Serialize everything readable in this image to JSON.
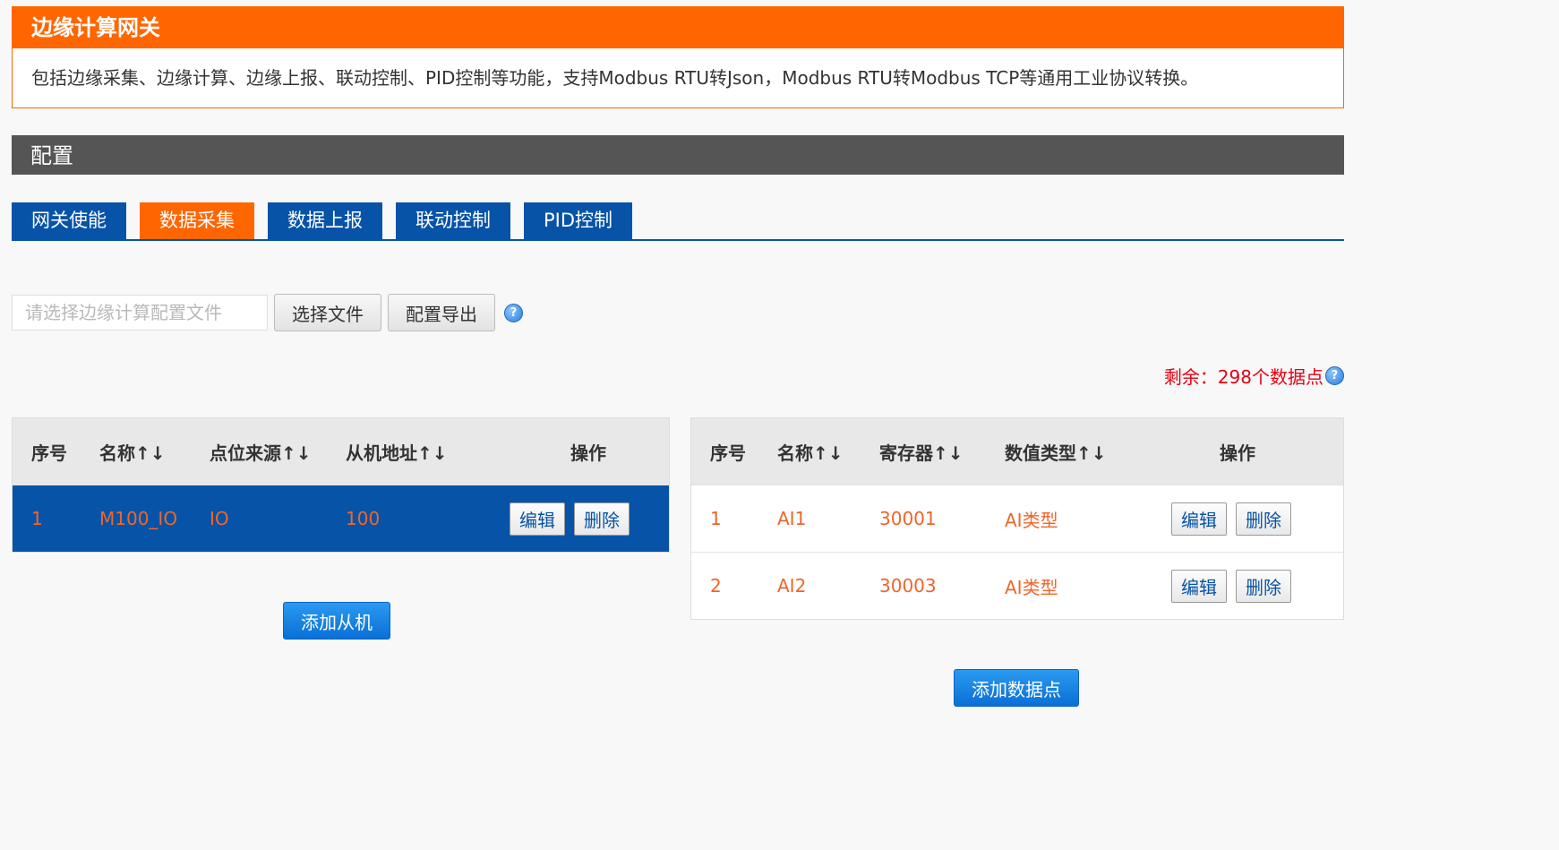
{
  "intro": {
    "title": "边缘计算网关",
    "description": "包括边缘采集、边缘计算、边缘上报、联动控制、PID控制等功能，支持Modbus RTU转Json，Modbus RTU转Modbus TCP等通用工业协议转换。"
  },
  "config": {
    "title": "配置",
    "tabs": [
      {
        "label": "网关使能",
        "active": false
      },
      {
        "label": "数据采集",
        "active": true
      },
      {
        "label": "数据上报",
        "active": false
      },
      {
        "label": "联动控制",
        "active": false
      },
      {
        "label": "PID控制",
        "active": false
      }
    ]
  },
  "file": {
    "placeholder": "请选择边缘计算配置文件",
    "value": "",
    "choose_label": "选择文件",
    "export_label": "配置导出",
    "help_icon": "question-circle-icon"
  },
  "remaining": {
    "text": "剩余：298个数据点"
  },
  "slave_table": {
    "headers": [
      "序号",
      "名称↑↓",
      "点位来源↑↓",
      "从机地址↑↓",
      "操作"
    ],
    "rows": [
      {
        "index": "1",
        "name": "M100_IO",
        "source": "IO",
        "address": "100",
        "selected": true
      }
    ],
    "edit_label": "编辑",
    "delete_label": "删除",
    "add_label": "添加从机"
  },
  "point_table": {
    "headers": [
      "序号",
      "名称↑↓",
      "寄存器↑↓",
      "数值类型↑↓",
      "操作"
    ],
    "rows": [
      {
        "index": "1",
        "name": "AI1",
        "register": "30001",
        "type": "AI类型"
      },
      {
        "index": "2",
        "name": "AI2",
        "register": "30003",
        "type": "AI类型"
      }
    ],
    "edit_label": "编辑",
    "delete_label": "删除",
    "add_label": "添加数据点"
  },
  "colors": {
    "accent_orange": "#ff6600",
    "primary_blue": "#0753a7",
    "section_gray": "#555555",
    "alert_red": "#e60012",
    "row_text_orange": "#f0652a"
  }
}
